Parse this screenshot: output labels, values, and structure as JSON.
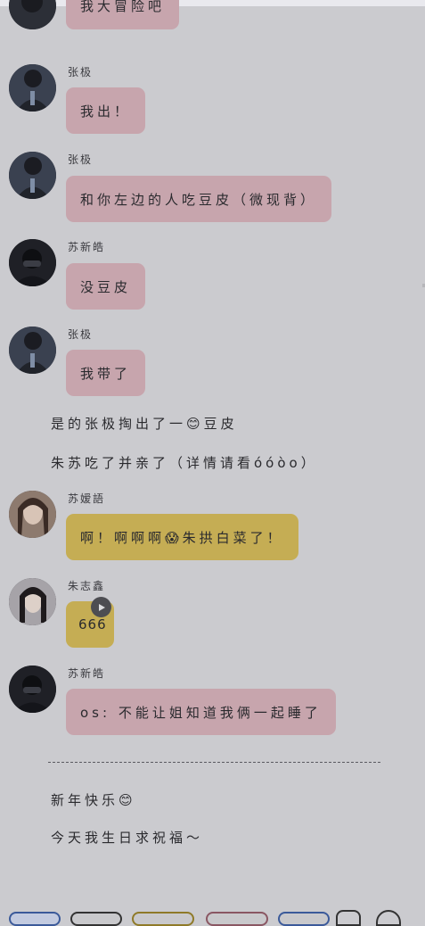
{
  "messages": [
    {
      "type": "bubble",
      "text": "我大冒险吧",
      "color": "pink"
    },
    {
      "type": "message",
      "name": "张极",
      "text": "我出！",
      "color": "pink"
    },
    {
      "type": "message",
      "name": "张极",
      "text": "和你左边的人吃豆皮（微现背）",
      "color": "pink"
    },
    {
      "type": "message",
      "name": "苏新皓",
      "text": "没豆皮",
      "color": "pink"
    },
    {
      "type": "message",
      "name": "张极",
      "text": "我带了",
      "color": "pink"
    },
    {
      "type": "narration",
      "text": "是的张极掏出了一😊豆皮"
    },
    {
      "type": "narration",
      "text": "朱苏吃了并亲了（详情请看óóòo）"
    },
    {
      "type": "message",
      "name": "苏嫒語",
      "text": "啊！啊啊啊😱朱拱白菜了！",
      "color": "gold"
    },
    {
      "type": "message",
      "name": "朱志鑫",
      "text": "666",
      "color": "gold"
    },
    {
      "type": "message",
      "name": "苏新皓",
      "text": "os: 不能让姐知道我俩一起睡了",
      "color": "pink"
    },
    {
      "type": "narration",
      "text": "新年快乐😊"
    },
    {
      "type": "narration",
      "text": "今天我生日求祝福～"
    }
  ],
  "colors": {
    "background": "#cbcbcf",
    "pink_bubble": "#c7a5ad",
    "gold_bubble": "#c5ad54"
  },
  "icons": [
    "play-icon",
    "avatar-zhangji",
    "avatar-suxinhao",
    "avatar-suaiyu",
    "avatar-zhuzhixin"
  ]
}
